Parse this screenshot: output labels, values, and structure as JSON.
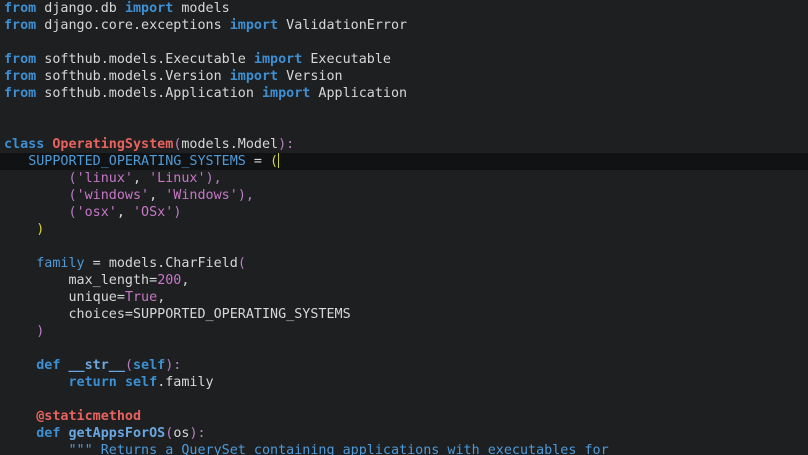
{
  "code": {
    "l1": {
      "kw1": "from",
      "mod": " django.db ",
      "kw2": "import",
      "name": " models"
    },
    "l2": {
      "kw1": "from",
      "mod": " django.core.exceptions ",
      "kw2": "import",
      "name": " ValidationError"
    },
    "l4": {
      "kw1": "from",
      "mod": " softhub.models.Executable ",
      "kw2": "import",
      "name": " Executable"
    },
    "l5": {
      "kw1": "from",
      "mod": " softhub.models.Version ",
      "kw2": "import",
      "name": " Version"
    },
    "l6": {
      "kw1": "from",
      "mod": " softhub.models.Application ",
      "kw2": "import",
      "name": " Application"
    },
    "l9": {
      "kw": "class",
      "space": " ",
      "cls": "OperatingSystem",
      "open": "(",
      "base": "models.Model",
      "close": "):"
    },
    "l10": {
      "indent": "   ",
      "ident": "SUPPORTED_OPERATING_SYSTEMS",
      "eq": " = ",
      "open": "("
    },
    "l11": {
      "indent": "        ",
      "open": "(",
      "s1": "'linux'",
      "comma": ", ",
      "s2": "'Linux'",
      "close": "),"
    },
    "l12": {
      "indent": "        ",
      "open": "(",
      "s1": "'windows'",
      "comma": ", ",
      "s2": "'Windows'",
      "close": "),"
    },
    "l13": {
      "indent": "        ",
      "open": "(",
      "s1": "'osx'",
      "comma": ", ",
      "s2": "'OSx'",
      "close": ")"
    },
    "l14": {
      "indent": "    ",
      "close": ")"
    },
    "l16": {
      "indent": "    ",
      "ident": "family",
      "eq": " = ",
      "call": "models.CharField",
      "open": "("
    },
    "l17": {
      "indent": "        ",
      "arg": "max_length=",
      "val": "200",
      "comma": ","
    },
    "l18": {
      "indent": "        ",
      "arg": "unique=",
      "val": "True",
      "comma": ","
    },
    "l19": {
      "indent": "        ",
      "arg": "choices=SUPPORTED_OPERATING_SYSTEMS"
    },
    "l20": {
      "indent": "    ",
      "close": ")"
    },
    "l22": {
      "indent": "    ",
      "kw": "def",
      "space": " ",
      "fn": "__str__",
      "open": "(",
      "self": "self",
      "close": "):"
    },
    "l23": {
      "indent": "        ",
      "kw": "return",
      "space": " ",
      "self": "self",
      "rest": ".family"
    },
    "l25": {
      "indent": "    ",
      "deco": "@staticmethod"
    },
    "l26": {
      "indent": "    ",
      "kw": "def",
      "space": " ",
      "fn": "getAppsForOS",
      "open": "(",
      "arg": "os",
      "close": "):"
    },
    "l27": {
      "indent": "        ",
      "doc": "\"\"\" Returns a QuerySet containing applications with executables for"
    }
  }
}
